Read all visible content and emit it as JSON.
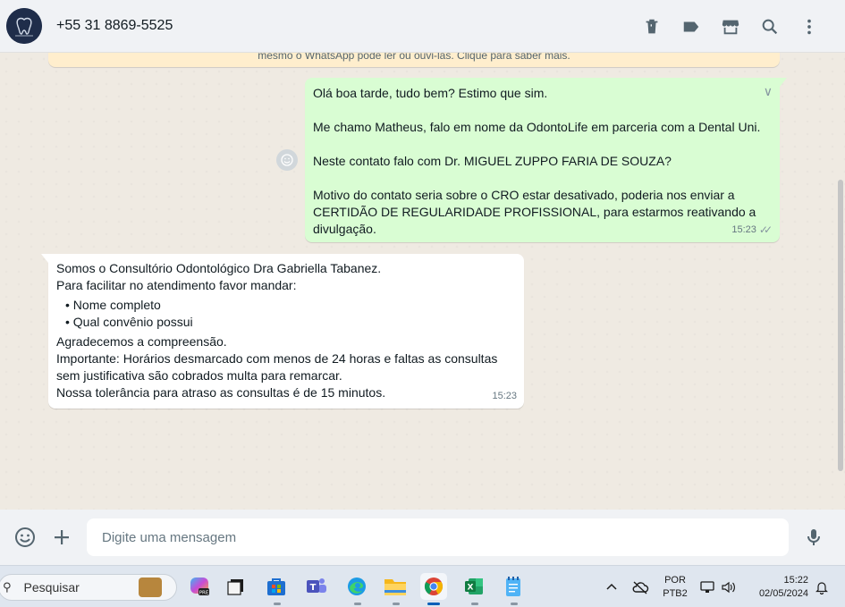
{
  "header": {
    "contact": "+55 31 8869-5525",
    "icons": [
      "delete-icon",
      "label-icon",
      "store-icon",
      "search-icon",
      "menu-icon"
    ]
  },
  "notice": {
    "text": "mesmo o WhatsApp pode ler ou ouvi-las. Clique para saber mais."
  },
  "outgoing": {
    "paragraphs": [
      "Olá boa tarde, tudo bem? Estimo que sim.",
      "Me chamo Matheus, falo em nome da OdontoLife em parceria com a Dental Uni.",
      "Neste contato falo com Dr. MIGUEL ZUPPO FARIA DE SOUZA?",
      "Motivo do contato seria sobre o CRO estar desativado, poderia nos enviar a CERTIDÃO DE REGULARIDADE PROFISSIONAL, para estarmos reativando a divulgação."
    ],
    "time": "15:23"
  },
  "incoming": {
    "line1": "Somos o  Consultório Odontológico Dra Gabriella Tabanez.",
    "line2": "Para facilitar no atendimento favor mandar:",
    "bullets": [
      "Nome completo",
      "Qual convênio possui"
    ],
    "line3": "Agradecemos a compreensão.",
    "line4": "Importante: Horários desmarcado com menos de 24 horas e faltas as consultas sem justificativa são cobrados multa para remarcar.",
    "line5": "Nossa tolerância para atraso as consultas é de 15 minutos.",
    "time": "15:23"
  },
  "composer": {
    "placeholder": "Digite uma mensagem"
  },
  "taskbar": {
    "search_label": "Pesquisar",
    "lang_top": "POR",
    "lang_bottom": "PTB2",
    "time": "15:22",
    "date": "02/05/2024",
    "colors": {
      "accent": "#005fb8",
      "out_bubble": "#d9fdd3",
      "chat_bg": "#efeae2"
    }
  }
}
